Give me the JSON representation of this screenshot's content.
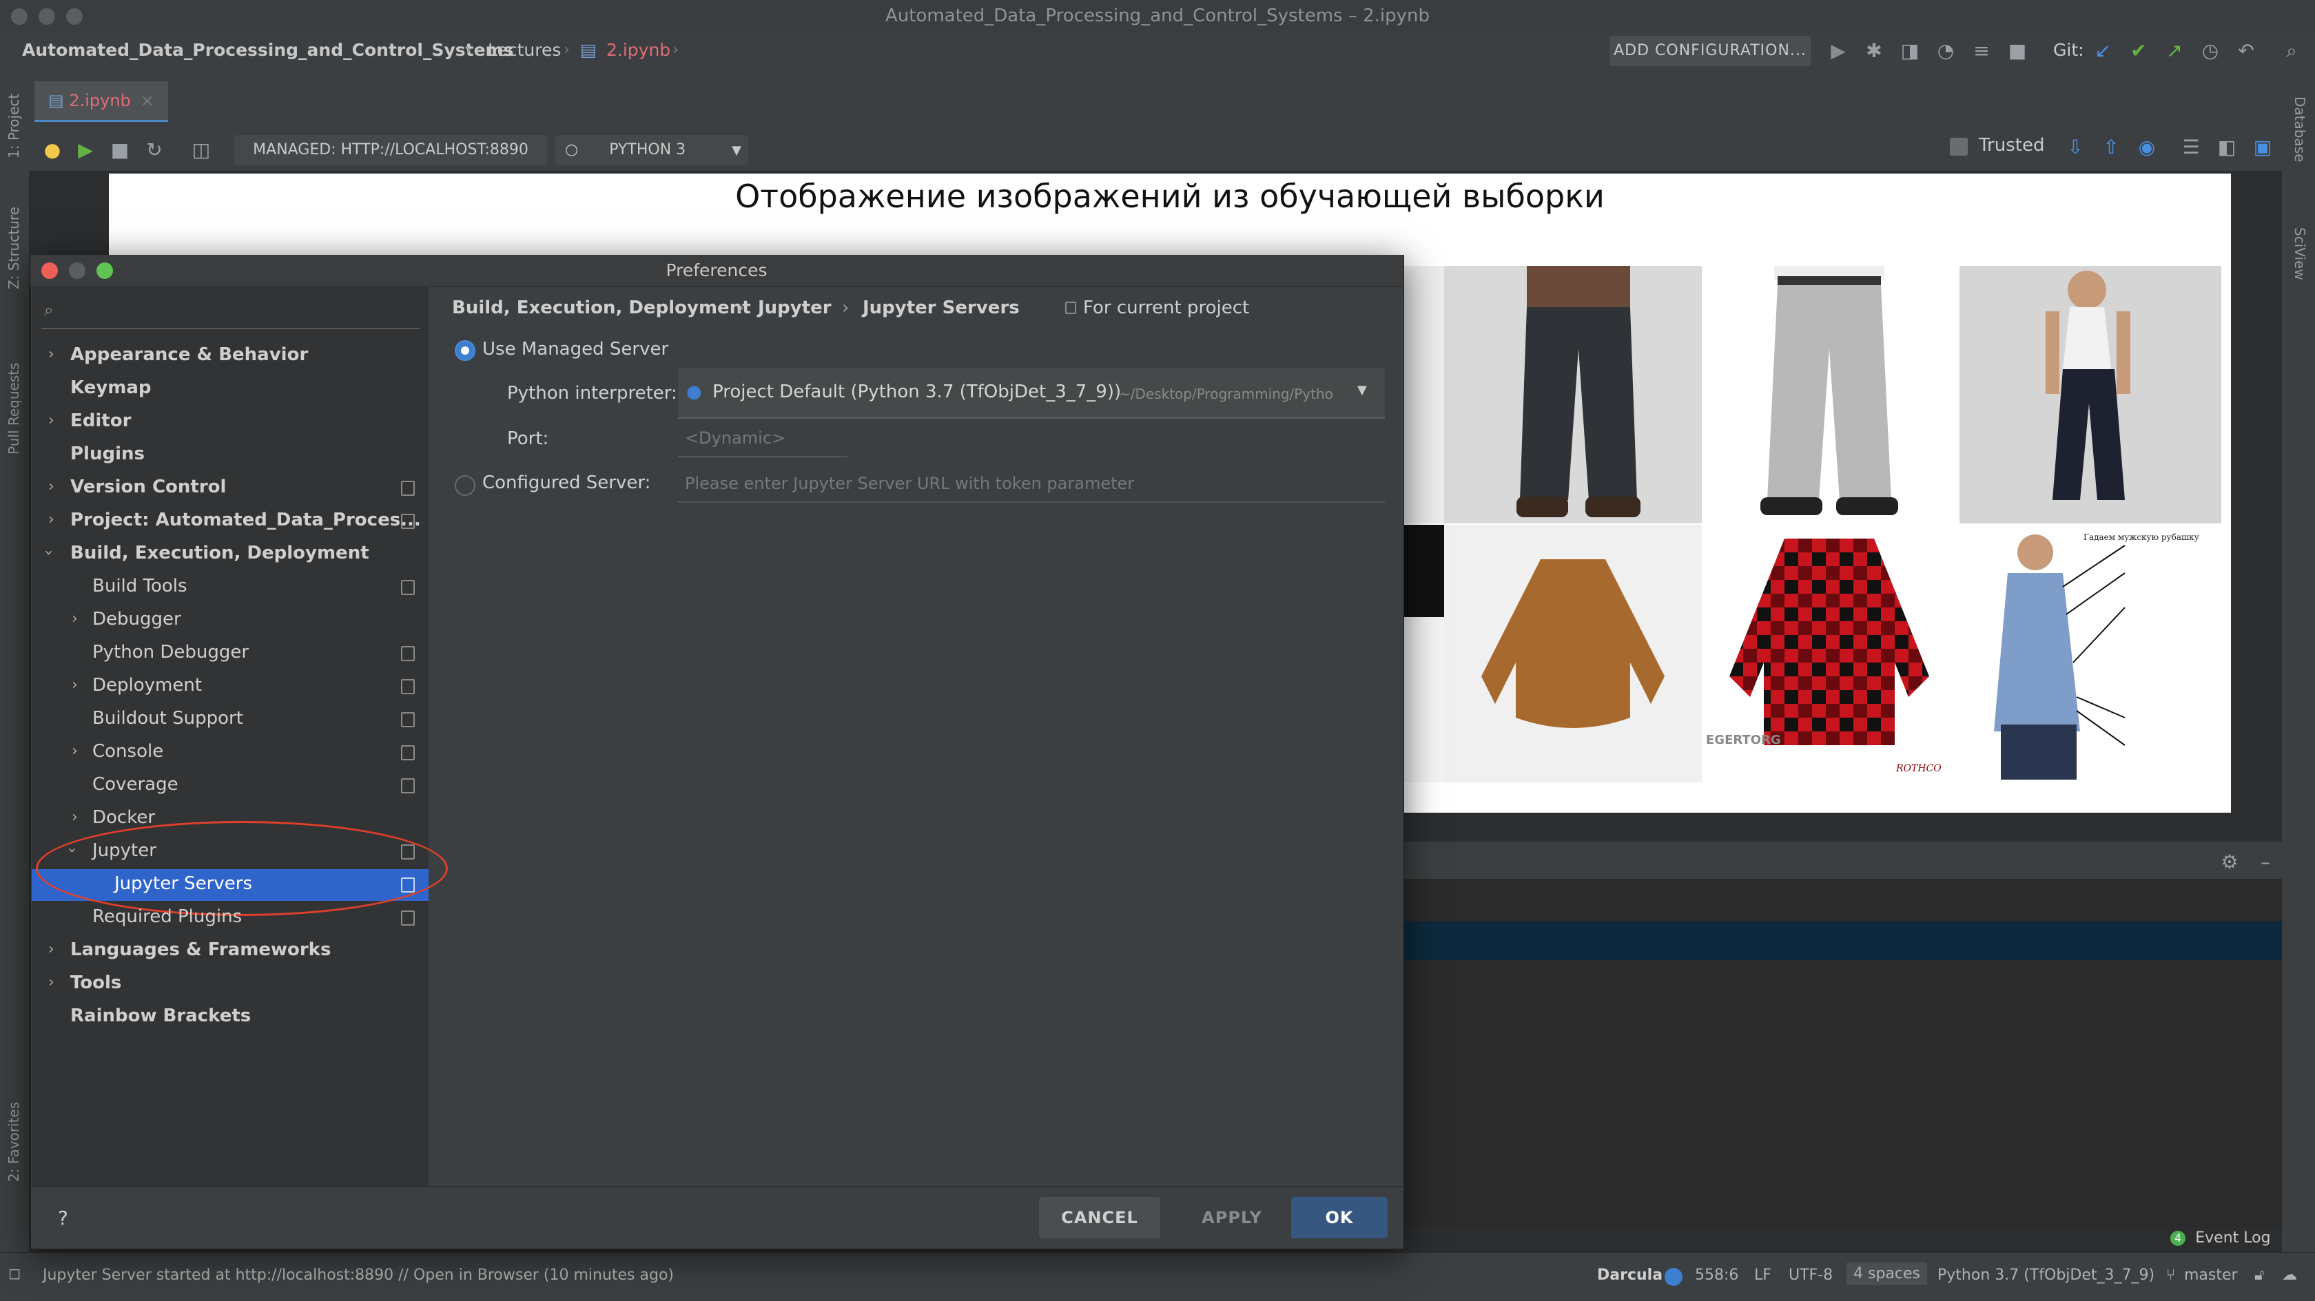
{
  "window": {
    "title": "Automated_Data_Processing_and_Control_Systems – 2.ipynb"
  },
  "breadcrumbs": [
    "Automated_Data_Processing_and_Control_Systems",
    "Lectures",
    "2.ipynb"
  ],
  "toolbar": {
    "add_configuration": "ADD CONFIGURATION...",
    "git_label": "Git:"
  },
  "side_tabs": {
    "project": "1: Project",
    "structure": "Z: Structure",
    "pull_requests": "Pull Requests",
    "favorites": "2: Favorites",
    "database": "Database",
    "sciview": "SciView"
  },
  "editor": {
    "file_tab": "2.ipynb",
    "server_pill": "MANAGED: HTTP://LOCALHOST:8890",
    "kernel_pill": "PYTHON 3",
    "trusted_label": "Trusted",
    "notebook_heading": "Отображение изображений из обучающей выборки"
  },
  "images": {
    "shirt_brand_label": "EGERTORG",
    "logo_text": "ROTHCO",
    "annotation_title": "Гадаем мужскую рубашку"
  },
  "dialog": {
    "title": "Preferences",
    "search_placeholder": "",
    "breadcrumb": [
      "Build, Execution, Deployment",
      "Jupyter",
      "Jupyter Servers"
    ],
    "scope_note": "For current project",
    "use_managed_server": "Use Managed Server",
    "interpreter_label": "Python interpreter:",
    "interpreter_value": "Project Default (Python 3.7 (TfObjDet_3_7_9))",
    "interpreter_path": "~/Desktop/Programming/Pytho",
    "port_label": "Port:",
    "port_placeholder": "<Dynamic>",
    "configured_server": "Configured Server:",
    "configured_placeholder": "Please enter Jupyter Server URL with token parameter",
    "help": "?",
    "cancel": "CANCEL",
    "apply": "APPLY",
    "ok": "OK",
    "tree": [
      {
        "label": "Appearance & Behavior"
      },
      {
        "label": "Keymap"
      },
      {
        "label": "Editor"
      },
      {
        "label": "Plugins"
      },
      {
        "label": "Version Control"
      },
      {
        "label": "Project: Automated_Data_Proces..."
      },
      {
        "label": "Build, Execution, Deployment"
      },
      {
        "label": "Build Tools"
      },
      {
        "label": "Debugger"
      },
      {
        "label": "Python Debugger"
      },
      {
        "label": "Deployment"
      },
      {
        "label": "Buildout Support"
      },
      {
        "label": "Console"
      },
      {
        "label": "Coverage"
      },
      {
        "label": "Docker"
      },
      {
        "label": "Jupyter"
      },
      {
        "label": "Jupyter Servers"
      },
      {
        "label": "Required Plugins"
      },
      {
        "label": "Languages & Frameworks"
      },
      {
        "label": "Tools"
      },
      {
        "label": "Rainbow Brackets"
      }
    ]
  },
  "status_bar": {
    "message": "Jupyter Server started at http://localhost:8890 // Open in Browser (10 minutes ago)",
    "event_log": "Event Log",
    "event_count": "4",
    "theme": "Darcula",
    "position": "558:6",
    "line_sep": "LF",
    "encoding": "UTF-8",
    "indent": "4 spaces",
    "interpreter": "Python 3.7 (TfObjDet_3_7_9)",
    "branch": "master"
  },
  "colors": {
    "selection": "#2f65ca",
    "highlight_oval": "#e0402a",
    "ok_button": "#365880"
  }
}
